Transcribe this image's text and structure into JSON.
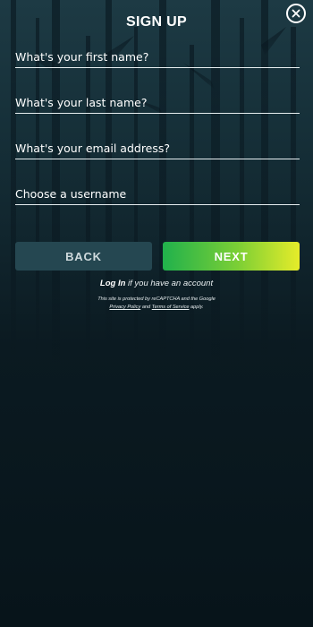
{
  "header": {
    "title": "SIGN UP",
    "close_icon": "close-circle-icon"
  },
  "form": {
    "first_name": {
      "placeholder": "What's your first name?",
      "value": ""
    },
    "last_name": {
      "placeholder": "What's your last name?",
      "value": ""
    },
    "email": {
      "placeholder": "What's your email address?",
      "value": ""
    },
    "username": {
      "placeholder": "Choose a username",
      "value": ""
    }
  },
  "actions": {
    "back_label": "BACK",
    "next_label": "NEXT"
  },
  "login": {
    "link_text": "Log In",
    "suffix": "if you have an account"
  },
  "recaptcha": {
    "prefix": "This site is protected by reCAPTCHA and the Google",
    "privacy_link": "Privacy Policy",
    "and_text": "and",
    "terms_link": "Terms of Service",
    "suffix": "apply."
  },
  "colors": {
    "background_top": "#1d3a44",
    "background_bottom": "#07141a",
    "back_button": "#254751",
    "next_gradient_start": "#20b14c",
    "next_gradient_end": "#e6ec2a"
  }
}
